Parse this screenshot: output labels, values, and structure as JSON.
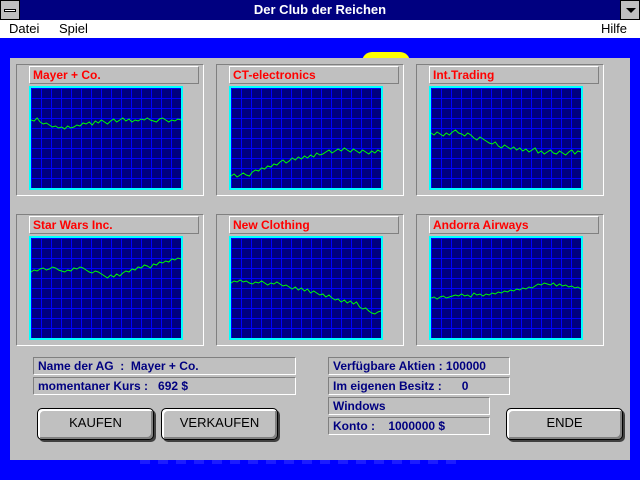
{
  "window": {
    "title": "Der Club der Reichen"
  },
  "menu": {
    "datei": "Datei",
    "spiel": "Spiel",
    "hilfe": "Hilfe"
  },
  "stocks": [
    {
      "name": "Mayer + Co.",
      "values": [
        68,
        67,
        70,
        66,
        64,
        65,
        63,
        61,
        62,
        60,
        61,
        59,
        62,
        60,
        61,
        63,
        62,
        65,
        64,
        66,
        63,
        67,
        65,
        68,
        66,
        64,
        67,
        69,
        66,
        68,
        70,
        67,
        69,
        66,
        68,
        67,
        69,
        68,
        70,
        68,
        67,
        66,
        69,
        70,
        68,
        66,
        68,
        67,
        69,
        68
      ]
    },
    {
      "name": "CT-electronics",
      "values": [
        12,
        14,
        11,
        13,
        15,
        13,
        12,
        16,
        18,
        17,
        20,
        19,
        22,
        21,
        24,
        23,
        26,
        28,
        25,
        27,
        30,
        28,
        31,
        29,
        32,
        30,
        33,
        31,
        35,
        33,
        34,
        36,
        38,
        35,
        37,
        39,
        37,
        40,
        38,
        36,
        39,
        37,
        35,
        38,
        36,
        34,
        37,
        35,
        38,
        36
      ]
    },
    {
      "name": "Int.Trading",
      "values": [
        55,
        53,
        56,
        54,
        52,
        55,
        53,
        56,
        58,
        55,
        54,
        52,
        55,
        53,
        50,
        48,
        51,
        49,
        47,
        45,
        44,
        46,
        42,
        40,
        43,
        41,
        39,
        41,
        38,
        40,
        37,
        39,
        36,
        38,
        40,
        35,
        37,
        34,
        36,
        38,
        35,
        34,
        37,
        35,
        33,
        36,
        38,
        34,
        37,
        36
      ]
    },
    {
      "name": "Star Wars Inc.",
      "values": [
        66,
        68,
        67,
        69,
        70,
        68,
        69,
        71,
        70,
        68,
        67,
        66,
        68,
        67,
        70,
        69,
        71,
        70,
        68,
        66,
        65,
        67,
        66,
        64,
        62,
        60,
        63,
        61,
        64,
        62,
        65,
        67,
        66,
        69,
        68,
        71,
        70,
        73,
        72,
        70,
        74,
        73,
        76,
        75,
        77,
        76,
        79,
        78,
        80,
        79
      ]
    },
    {
      "name": "New Clothing",
      "values": [
        55,
        57,
        56,
        58,
        56,
        57,
        55,
        54,
        56,
        55,
        57,
        55,
        53,
        55,
        54,
        56,
        54,
        52,
        53,
        51,
        49,
        51,
        48,
        50,
        47,
        49,
        45,
        47,
        45,
        43,
        44,
        41,
        43,
        40,
        38,
        39,
        36,
        38,
        35,
        37,
        34,
        36,
        31,
        29,
        30,
        27,
        25,
        24,
        26,
        27
      ]
    },
    {
      "name": "Andorra Airways",
      "values": [
        40,
        41,
        39,
        41,
        42,
        40,
        41,
        42,
        43,
        42,
        44,
        42,
        43,
        41,
        45,
        43,
        44,
        42,
        44,
        43,
        45,
        44,
        46,
        45,
        47,
        46,
        48,
        47,
        49,
        48,
        50,
        49,
        51,
        50,
        52,
        54,
        53,
        55,
        54,
        53,
        55,
        52,
        54,
        52,
        53,
        51,
        52,
        50,
        51,
        49
      ]
    }
  ],
  "info": {
    "name_label": "Name der AG  :  Mayer + Co.",
    "kurs_label": "momentaner Kurs :   692 $",
    "aktien_label": "Verfügbare Aktien : 100000",
    "besitz_label": "Im eigenen Besitz :      0",
    "windows_label": "Windows",
    "konto_label": "Konto :    1000000 $"
  },
  "buttons": {
    "kaufen": "KAUFEN",
    "verkaufen": "VERKAUFEN",
    "ende": "ENDE"
  },
  "colors": {
    "title_bar": "#000080",
    "desktop": "#0000ff",
    "panel": "#c0c0c0",
    "chart_bg": "#000080",
    "chart_grid": "#0000ff",
    "chart_line": "#00ff00",
    "chart_border": "#00ffff",
    "stock_name": "#ff0000",
    "info_text": "#000080"
  }
}
